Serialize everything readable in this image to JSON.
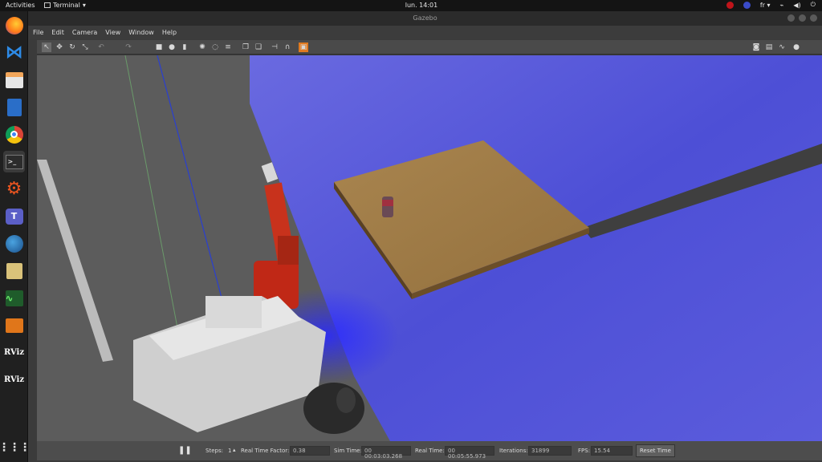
{
  "topbar": {
    "activities": "Activities",
    "app_name": "Terminal",
    "clock": "lun. 14:01",
    "keyboard_layout": "fr"
  },
  "window": {
    "title": "Gazebo"
  },
  "menu": {
    "items": [
      "File",
      "Edit",
      "Camera",
      "View",
      "Window",
      "Help"
    ]
  },
  "dock": {
    "items": [
      {
        "name": "firefox",
        "label": ""
      },
      {
        "name": "vscode",
        "label": ""
      },
      {
        "name": "files",
        "label": ""
      },
      {
        "name": "document",
        "label": ""
      },
      {
        "name": "chrome",
        "label": ""
      },
      {
        "name": "terminal",
        "label": ""
      },
      {
        "name": "settings",
        "label": ""
      },
      {
        "name": "teams",
        "label": ""
      },
      {
        "name": "network",
        "label": ""
      },
      {
        "name": "image-viewer",
        "label": ""
      },
      {
        "name": "system-monitor",
        "label": ""
      },
      {
        "name": "package",
        "label": ""
      },
      {
        "name": "rviz-1",
        "label": "RViz"
      },
      {
        "name": "rviz-2",
        "label": "RViz"
      },
      {
        "name": "apps-grid",
        "label": ""
      }
    ]
  },
  "status": {
    "steps_label": "Steps:",
    "steps_value": "1",
    "rtf_label": "Real Time Factor:",
    "rtf_value": "0.38",
    "sim_time_label": "Sim Time:",
    "sim_time_value": "00 00:03:03.268",
    "real_time_label": "Real Time:",
    "real_time_value": "00 00:05:55.973",
    "iterations_label": "Iterations:",
    "iterations_value": "31899",
    "fps_label": "FPS:",
    "fps_value": "15.54",
    "reset_label": "Reset Time"
  },
  "colors": {
    "ground_blue": "#4a4ad0",
    "table_wood": "#a07c4a",
    "arm_red": "#cc2a1a",
    "robot_grey": "#cfcfcf"
  }
}
